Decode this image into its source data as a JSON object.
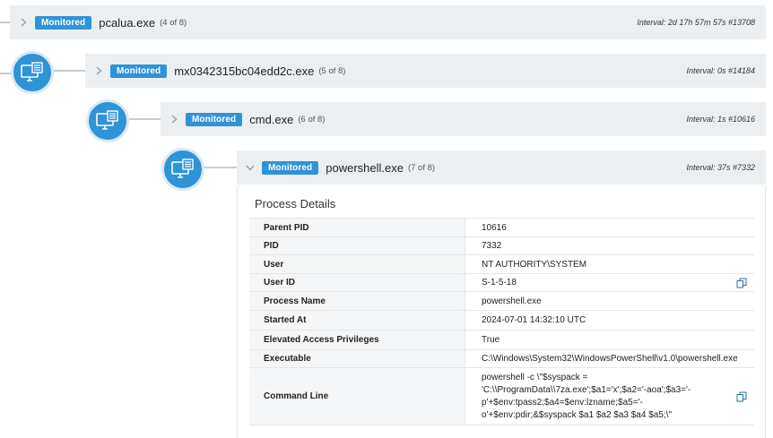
{
  "process_tree": [
    {
      "badge": "Monitored",
      "name": "pcalua.exe",
      "count": "(4 of 8)",
      "interval": "Interval: 2d 17h 57m 57s #13708",
      "expanded": false
    },
    {
      "badge": "Monitored",
      "name": "mx0342315bc04edd2c.exe",
      "count": "(5 of 8)",
      "interval": "Interval: 0s #14184",
      "expanded": false
    },
    {
      "badge": "Monitored",
      "name": "cmd.exe",
      "count": "(6 of 8)",
      "interval": "Interval: 1s #10616",
      "expanded": false
    },
    {
      "badge": "Monitored",
      "name": "powershell.exe",
      "count": "(7 of 8)",
      "interval": "Interval: 37s #7332",
      "expanded": true
    }
  ],
  "details": {
    "title": "Process Details",
    "rows": [
      {
        "label": "Parent PID",
        "value": "10616"
      },
      {
        "label": "PID",
        "value": "7332"
      },
      {
        "label": "User",
        "value": "NT AUTHORITY\\SYSTEM"
      },
      {
        "label": "User ID",
        "value": "S-1-5-18"
      },
      {
        "label": "Process Name",
        "value": "powershell.exe"
      },
      {
        "label": "Started At",
        "value": "2024-07-01 14:32:10 UTC"
      },
      {
        "label": "Elevated Access Privileges",
        "value": "True"
      },
      {
        "label": "Executable",
        "value": "C:\\Windows\\System32\\WindowsPowerShell\\v1.0\\powershell.exe"
      },
      {
        "label": "Command Line",
        "value": "powershell -c \\\"$syspack = 'C:\\\\ProgramData\\\\7za.exe';$a1='x';$a2='-aoa';$a3='-p'+$env:tpass2;$a4=$env:lzname;$a5='-o'+$env:pdir;&$syspack $a1 $a2 $a3 $a4 $a5;\\\""
      }
    ]
  },
  "icons": {
    "node": "computer-process-icon",
    "copy": "copy-icon",
    "chevron_right": "chevron-right-icon",
    "chevron_down": "chevron-down-icon"
  },
  "colors": {
    "accent": "#2f93d8",
    "row_bg": "#eceff1"
  }
}
